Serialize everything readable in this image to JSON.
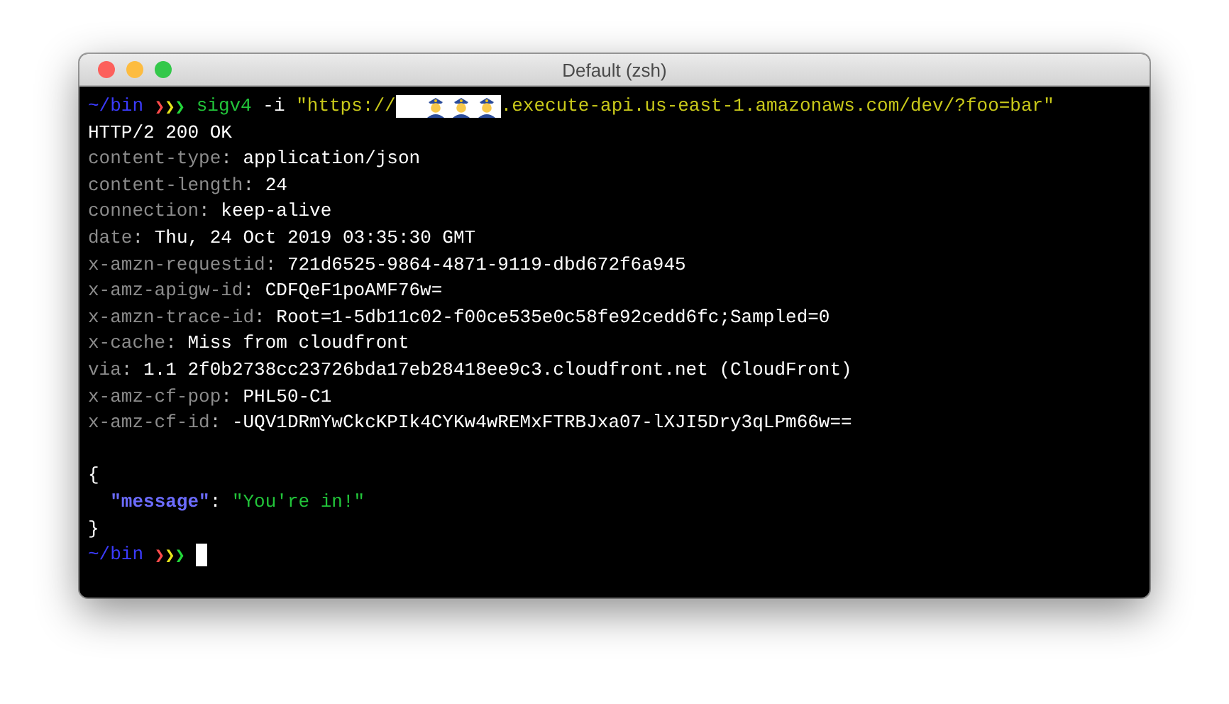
{
  "window": {
    "title": "Default (zsh)"
  },
  "lines": [
    {
      "kind": "prompt",
      "path": "~/bin",
      "symbols": [
        {
          "text": "❯",
          "color": "#ff4b4b"
        },
        {
          "text": "❯",
          "color": "#e6e61a"
        },
        {
          "text": "❯",
          "color": "#22d83a"
        }
      ],
      "command": "sigv4",
      "args": "-i",
      "url_start": "\"https://",
      "url_redacted": true,
      "url_end": ".execute-api.us-east-1.amazonaws.com/dev/?foo=bar\"",
      "cursor": false
    },
    {
      "kind": "status",
      "text": "HTTP/2 200 OK"
    },
    {
      "kind": "header",
      "name": "content-type",
      "sep": ":",
      "value": "application/json"
    },
    {
      "kind": "header",
      "name": "content-length",
      "sep": ":",
      "value": "24"
    },
    {
      "kind": "header",
      "name": "connection",
      "sep": ":",
      "value": "keep-alive"
    },
    {
      "kind": "header",
      "name": "date",
      "sep": ":",
      "value": "Thu, 24 Oct 2019 03:35:30 GMT"
    },
    {
      "kind": "header",
      "name": "x-amzn-requestid",
      "sep": ":",
      "value": "721d6525-9864-4871-9119-dbd672f6a945"
    },
    {
      "kind": "header",
      "name": "x-amz-apigw-id",
      "sep": ":",
      "value": "CDFQeF1poAMF76w="
    },
    {
      "kind": "header",
      "name": "x-amzn-trace-id",
      "sep": ":",
      "value": "Root=1-5db11c02-f00ce535e0c58fe92cedd6fc;Sampled=0"
    },
    {
      "kind": "header",
      "name": "x-cache",
      "sep": ":",
      "value": "Miss from cloudfront"
    },
    {
      "kind": "header",
      "name": "via",
      "sep": ":",
      "value": "1.1 2f0b2738cc23726bda17eb28418ee9c3.cloudfront.net (CloudFront)"
    },
    {
      "kind": "header",
      "name": "x-amz-cf-pop",
      "sep": ":",
      "value": "PHL50-C1"
    },
    {
      "kind": "header",
      "name": "x-amz-cf-id",
      "sep": ":",
      "value": "-UQV1DRmYwCkcKPIk4CYKw4wREMxFTRBJxa07-lXJI5Dry3qLPm66w=="
    },
    {
      "kind": "blank"
    },
    {
      "kind": "brace",
      "text": "{"
    },
    {
      "kind": "json_pair",
      "key": "\"message\"",
      "sep": ":",
      "value": "\"You're in!\""
    },
    {
      "kind": "brace",
      "text": "}"
    },
    {
      "kind": "prompt",
      "path": "~/bin",
      "symbols": [
        {
          "text": "❯",
          "color": "#ff4b4b"
        },
        {
          "text": "❯",
          "color": "#e6e61a"
        },
        {
          "text": "❯",
          "color": "#22d83a"
        }
      ],
      "cursor": true
    }
  ]
}
